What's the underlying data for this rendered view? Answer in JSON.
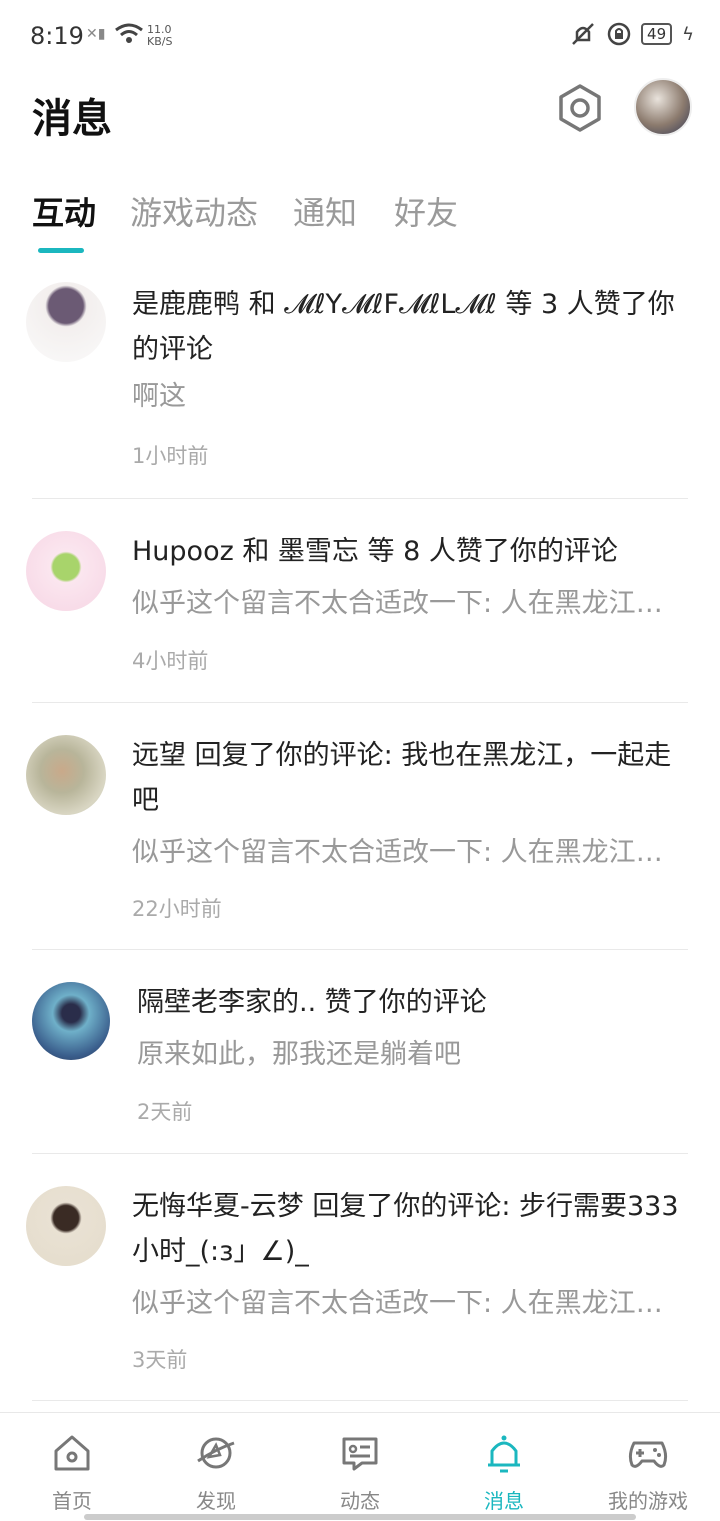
{
  "status_bar": {
    "time": "8:19",
    "net_speed": "11.0",
    "net_unit": "KB/S",
    "battery": "49"
  },
  "header": {
    "title": "消息"
  },
  "tabs": [
    {
      "label": "互动",
      "active": true
    },
    {
      "label": "游戏动态",
      "active": false
    },
    {
      "label": "通知",
      "active": false
    },
    {
      "label": "好友",
      "active": false
    }
  ],
  "items": [
    {
      "headline": "是鹿鹿鸭 和 𝓜ℓY𝓜ℓF𝓜ℓL𝓜ℓ 等 3 人赞了你的评论",
      "sub": "啊这",
      "time": "1小时前"
    },
    {
      "headline": "Hupooz 和 墨雪忘 等 8 人赞了你的评论",
      "sub": "似乎这个留言不太合适改一下: 人在黑龙江，想看南方的雪",
      "time": "4小时前"
    },
    {
      "headline": "远望 回复了你的评论: 我也在黑龙江，一起走吧",
      "sub": "似乎这个留言不太合适改一下: 人在黑龙江，想看南方的雪",
      "time": "22小时前"
    },
    {
      "headline": "隔壁老李家的.. 赞了你的评论",
      "sub": "原来如此，那我还是躺着吧",
      "time": "2天前"
    },
    {
      "headline": "无悔华夏-云梦 回复了你的评论: 步行需要333小时_(:з」∠)_",
      "sub": "似乎这个留言不太合适改一下: 人在黑龙江，想看南方的雪",
      "time": "3天前"
    }
  ],
  "bottom_nav": [
    {
      "label": "首页",
      "icon": "home-icon"
    },
    {
      "label": "发现",
      "icon": "planet-icon"
    },
    {
      "label": "动态",
      "icon": "chat-card-icon"
    },
    {
      "label": "消息",
      "icon": "bell-icon",
      "active": true
    },
    {
      "label": "我的游戏",
      "icon": "gamepad-icon"
    }
  ],
  "colors": {
    "accent": "#1bb7bf"
  }
}
